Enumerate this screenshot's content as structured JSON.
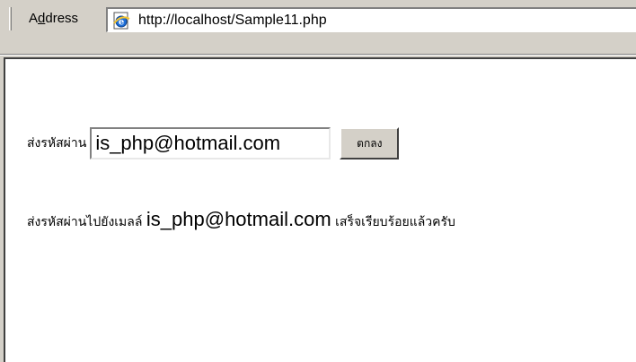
{
  "address_bar": {
    "label_prefix": "A",
    "label_accel": "d",
    "label_suffix": "dress",
    "url": "http://localhost/Sample11.php",
    "page_icon": "ie-page-icon"
  },
  "form": {
    "label": "ส่งรหัสผ่าน",
    "email_value": "is_php@hotmail.com",
    "submit_label": "ตกลง"
  },
  "result": {
    "prefix": "ส่งรหัสผ่านไปยังเมลล์ ",
    "email": "is_php@hotmail.com",
    "suffix": " เสร็จเรียบร้อยแล้วครับ"
  },
  "colors": {
    "chrome": "#d4d0c8",
    "content_bg": "#ffffff"
  }
}
